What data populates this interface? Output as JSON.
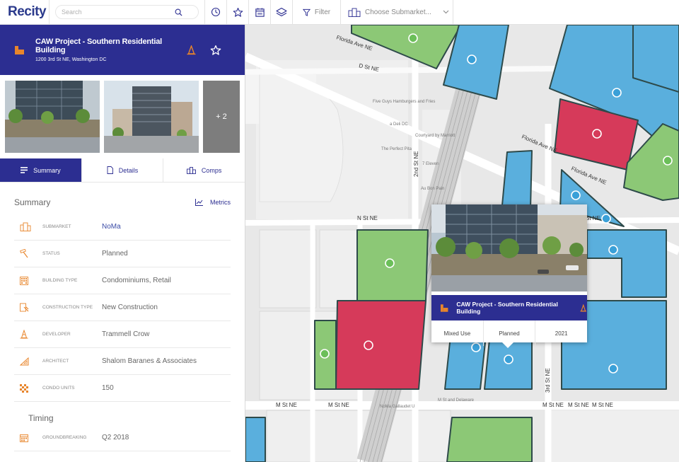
{
  "app": {
    "logo": "Recity"
  },
  "toolbar": {
    "search_placeholder": "Search",
    "filter_label": "Filter",
    "submarket_label": "Choose Submarket..."
  },
  "project": {
    "title": "CAW Project - Southern Residential Building",
    "address": "1200 3rd St NE, Washington DC",
    "more_photos": "+ 2"
  },
  "tabs": [
    {
      "label": "Summary",
      "active": true
    },
    {
      "label": "Details",
      "active": false
    },
    {
      "label": "Comps",
      "active": false
    }
  ],
  "summary": {
    "title": "Summary",
    "metrics_label": "Metrics",
    "rows": [
      {
        "icon": "submarket-icon",
        "label": "SUBMARKET",
        "value": "NoMa"
      },
      {
        "icon": "hammer-icon",
        "label": "STATUS",
        "value": "Planned"
      },
      {
        "icon": "building-type-icon",
        "label": "BUILDING TYPE",
        "value": "Condominiums, Retail"
      },
      {
        "icon": "construction-icon",
        "label": "CONSTRUCTION TYPE",
        "value": "New Construction"
      },
      {
        "icon": "developer-icon",
        "label": "DEVELOPER",
        "value": "Trammell Crow"
      },
      {
        "icon": "architect-icon",
        "label": "ARCHITECT",
        "value": "Shalom Baranes & Associates"
      },
      {
        "icon": "units-icon",
        "label": "CONDO UNITS",
        "value": "150"
      }
    ]
  },
  "timing": {
    "title": "Timing",
    "rows": [
      {
        "icon": "calendar-icon",
        "label": "GROUNDBREAKING",
        "value": "Q2 2018"
      }
    ]
  },
  "map": {
    "streets": {
      "florida1": "Florida Ave NE",
      "florida2": "Florida Ave NE",
      "florida3": "Florida Ave NE",
      "d_st": "D St NE",
      "n_st_left": "N St NE",
      "n_st_right": "N St NE",
      "m_st1": "M St NE",
      "m_st2": "M St NE",
      "m_st3": "M St NE",
      "m_st4": "M St NE",
      "m_st5": "M St NE",
      "second_st": "2nd St NE",
      "third_st": "3rd St NE"
    },
    "pois": {
      "five_guys": "Five Guys Hamburgers and Fries",
      "deli": "a Deli DC",
      "courtyard": "Courtyard by Marriott",
      "perfect_pita": "The Perfect Pita",
      "seven_eleven": "7 Eleven",
      "au_bon_pain": "Au Bon Pain",
      "noma_station": "NoMa Gallaudet U",
      "m_delaware": "M St and Delaware"
    },
    "colors": {
      "green": "#8cc876",
      "blue": "#5aafdd",
      "red": "#d63a5a",
      "outline": "#2e4a4a",
      "navy": "#2c2e91",
      "orange": "#e8852b"
    }
  },
  "popup": {
    "title": "CAW Project - Southern Residential Building",
    "stats": [
      "Mixed Use",
      "Planned",
      "2021"
    ]
  }
}
